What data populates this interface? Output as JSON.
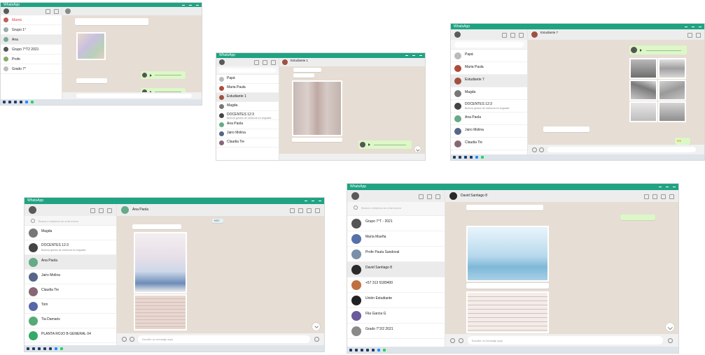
{
  "shot1": {
    "title": "WhatsApp",
    "chats": [
      {
        "name": "Mamá",
        "preview": "",
        "time": ""
      },
      {
        "name": "Grupo 1°",
        "preview": "",
        "time": ""
      },
      {
        "name": "Ana",
        "preview": "",
        "time": ""
      },
      {
        "name": "Grupo 7°T2 2021",
        "preview": "",
        "time": ""
      },
      {
        "name": "Profe",
        "preview": "",
        "time": ""
      },
      {
        "name": "Grado 7°",
        "preview": "",
        "time": ""
      }
    ]
  },
  "shot2": {
    "title": "WhatsApp",
    "chat_name": "Estudiante 1",
    "chats": [
      {
        "name": "Papá",
        "preview": "",
        "time": ""
      },
      {
        "name": "Maria Paula",
        "preview": "",
        "time": ""
      },
      {
        "name": "Estudiante 1",
        "preview": "",
        "time": ""
      },
      {
        "name": "Magda",
        "preview": "",
        "time": ""
      },
      {
        "name": "DOCENTES 12:3",
        "preview": "Buenos gestos de violencia en angustia",
        "time": ""
      },
      {
        "name": "Ana Paola",
        "preview": "",
        "time": ""
      },
      {
        "name": "Jairo Molina",
        "preview": "",
        "time": ""
      },
      {
        "name": "Claudia Tie",
        "preview": "",
        "time": ""
      }
    ]
  },
  "shot3": {
    "title": "WhatsApp",
    "chat_name": "Estudiante 7",
    "chats": [
      {
        "name": "Papá",
        "preview": "",
        "time": ""
      },
      {
        "name": "Maria Paula",
        "preview": "",
        "time": ""
      },
      {
        "name": "Estudiante 7",
        "preview": "",
        "time": ""
      },
      {
        "name": "Magda",
        "preview": "",
        "time": ""
      },
      {
        "name": "DOCENTES 12:3",
        "preview": "Buenos gestos de violencia en angustia",
        "time": ""
      },
      {
        "name": "Ana Paola",
        "preview": "",
        "time": ""
      },
      {
        "name": "Jairo Molina",
        "preview": "",
        "time": ""
      },
      {
        "name": "Claudia Tie",
        "preview": "",
        "time": ""
      }
    ]
  },
  "shot4": {
    "title": "WhatsApp",
    "chat_name": "Ana Paola",
    "search_placeholder": "Busca o empieza un chat nuevo",
    "composer_placeholder": "Escribe un mensaje aquí",
    "today_label": "HOY",
    "chats": [
      {
        "name": "Magda",
        "preview": "",
        "time": ""
      },
      {
        "name": "DOCENTES 12:3",
        "preview": "Buenos gestos de violencia en angustia",
        "time": ""
      },
      {
        "name": "Ana Paola",
        "preview": "",
        "time": ""
      },
      {
        "name": "Jairo Molina",
        "preview": "",
        "time": ""
      },
      {
        "name": "Claudia Tie",
        "preview": "",
        "time": ""
      },
      {
        "name": "Tom",
        "preview": "",
        "time": ""
      },
      {
        "name": "Tia Damaris",
        "preview": "",
        "time": ""
      },
      {
        "name": "PLANTA ROJO B GENERAL 04",
        "preview": "",
        "time": ""
      }
    ]
  },
  "shot5": {
    "title": "WhatsApp",
    "chat_name": "David Santiago 8",
    "search_placeholder": "Busca o empieza un chat nuevo",
    "composer_placeholder": "Escribe un mensaje aquí",
    "chats": [
      {
        "name": "Grupo 7°T - 2021",
        "preview": "",
        "time": ""
      },
      {
        "name": "María Mueña",
        "preview": "",
        "time": ""
      },
      {
        "name": "Profe Paula Sandoval",
        "preview": "",
        "time": ""
      },
      {
        "name": "David Santiago 8",
        "preview": "",
        "time": ""
      },
      {
        "name": "+57 313 5189400",
        "preview": "",
        "time": ""
      },
      {
        "name": "Unión Estudiante",
        "preview": "",
        "time": ""
      },
      {
        "name": "Flia Garcia G",
        "preview": "",
        "time": ""
      },
      {
        "name": "Grado 7°2/2 2021",
        "preview": "",
        "time": ""
      }
    ]
  },
  "colors": {
    "brand": "#1fa383",
    "sent_bubble": "#dcf8c6",
    "chat_bg": "#e6ddd4",
    "selected_chat": "#ebebeb"
  }
}
